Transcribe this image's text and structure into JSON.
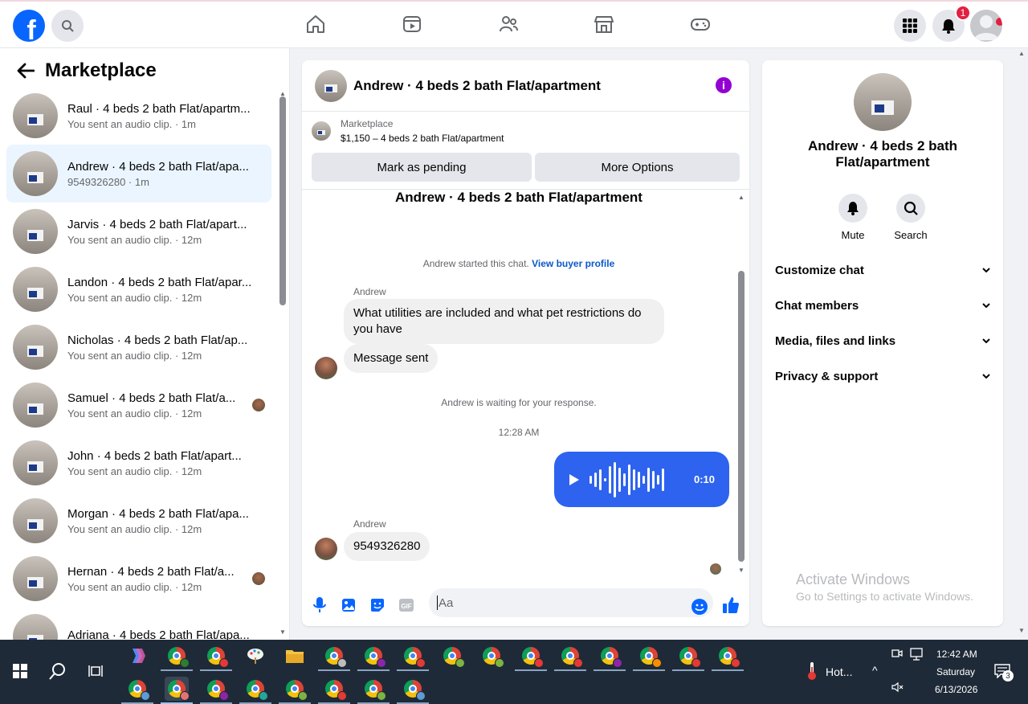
{
  "topbar": {
    "logo_letter": "f",
    "notification_count": "1",
    "nav_icons": [
      "home-icon",
      "video-icon",
      "friends-icon",
      "marketplace-icon",
      "gaming-icon"
    ]
  },
  "sidebar": {
    "title": "Marketplace",
    "conversations": [
      {
        "title": "Raul · 4 beds 2 bath Flat/apartm...",
        "subtitle": "You sent an audio clip. · 1m",
        "active": false,
        "read_avatar": false
      },
      {
        "title": "Andrew · 4 beds 2 bath Flat/apa...",
        "subtitle": "9549326280 · 1m",
        "active": true,
        "read_avatar": false
      },
      {
        "title": "Jarvis · 4 beds 2 bath Flat/apart...",
        "subtitle": "You sent an audio clip. · 12m",
        "active": false,
        "read_avatar": false
      },
      {
        "title": "Landon · 4 beds 2 bath Flat/apar...",
        "subtitle": "You sent an audio clip. · 12m",
        "active": false,
        "read_avatar": false
      },
      {
        "title": "Nicholas · 4 beds 2 bath Flat/ap...",
        "subtitle": "You sent an audio clip. · 12m",
        "active": false,
        "read_avatar": false
      },
      {
        "title": "Samuel · 4 beds 2 bath Flat/a...",
        "subtitle": "You sent an audio clip. · 12m",
        "active": false,
        "read_avatar": true
      },
      {
        "title": "John · 4 beds 2 bath Flat/apart...",
        "subtitle": "You sent an audio clip. · 12m",
        "active": false,
        "read_avatar": false
      },
      {
        "title": "Morgan · 4 beds 2 bath Flat/apa...",
        "subtitle": "You sent an audio clip. · 12m",
        "active": false,
        "read_avatar": false
      },
      {
        "title": "Hernan · 4 beds 2 bath Flat/a...",
        "subtitle": "You sent an audio clip. · 12m",
        "active": false,
        "read_avatar": true
      },
      {
        "title": "Adriana · 4 beds 2 bath Flat/apa...",
        "subtitle": "",
        "active": false,
        "read_avatar": false
      }
    ]
  },
  "chat": {
    "header_title": "Andrew · 4 beds 2 bath Flat/apartment",
    "listing_label": "Marketplace",
    "listing_price": "$1,150 – 4 beds 2 bath Flat/apartment",
    "mark_pending_label": "Mark as pending",
    "more_options_label": "More Options",
    "topic": "Andrew · 4 beds 2 bath Flat/apartment",
    "started_text": "Andrew started this chat.",
    "view_profile_link": "View buyer profile",
    "sender_name_1": "Andrew",
    "message_1": "What utilities are included and what pet restrictions do you have",
    "message_2": "Message sent",
    "waiting_text": "Andrew is waiting for your response.",
    "timestamp": "12:28 AM",
    "audio_duration": "0:10",
    "sender_name_2": "Andrew",
    "message_3": "9549326280",
    "input_placeholder": "Aa"
  },
  "info_panel": {
    "title": "Andrew · 4 beds 2 bath Flat/apartment",
    "mute_label": "Mute",
    "search_label": "Search",
    "sections": [
      "Customize chat",
      "Chat members",
      "Media, files and links",
      "Privacy & support"
    ]
  },
  "watermark": {
    "line1": "Activate Windows",
    "line2": "Go to Settings to activate Windows."
  },
  "taskbar": {
    "weather": "Hot...",
    "time": "12:42 AM",
    "day": "Saturday",
    "date": "6/13/2026",
    "notification_count": "3"
  },
  "colors": {
    "brand": "#0866ff",
    "audio_bubble": "#2d63ee",
    "badge": "#e41e3f",
    "active_row": "#ebf5ff"
  }
}
